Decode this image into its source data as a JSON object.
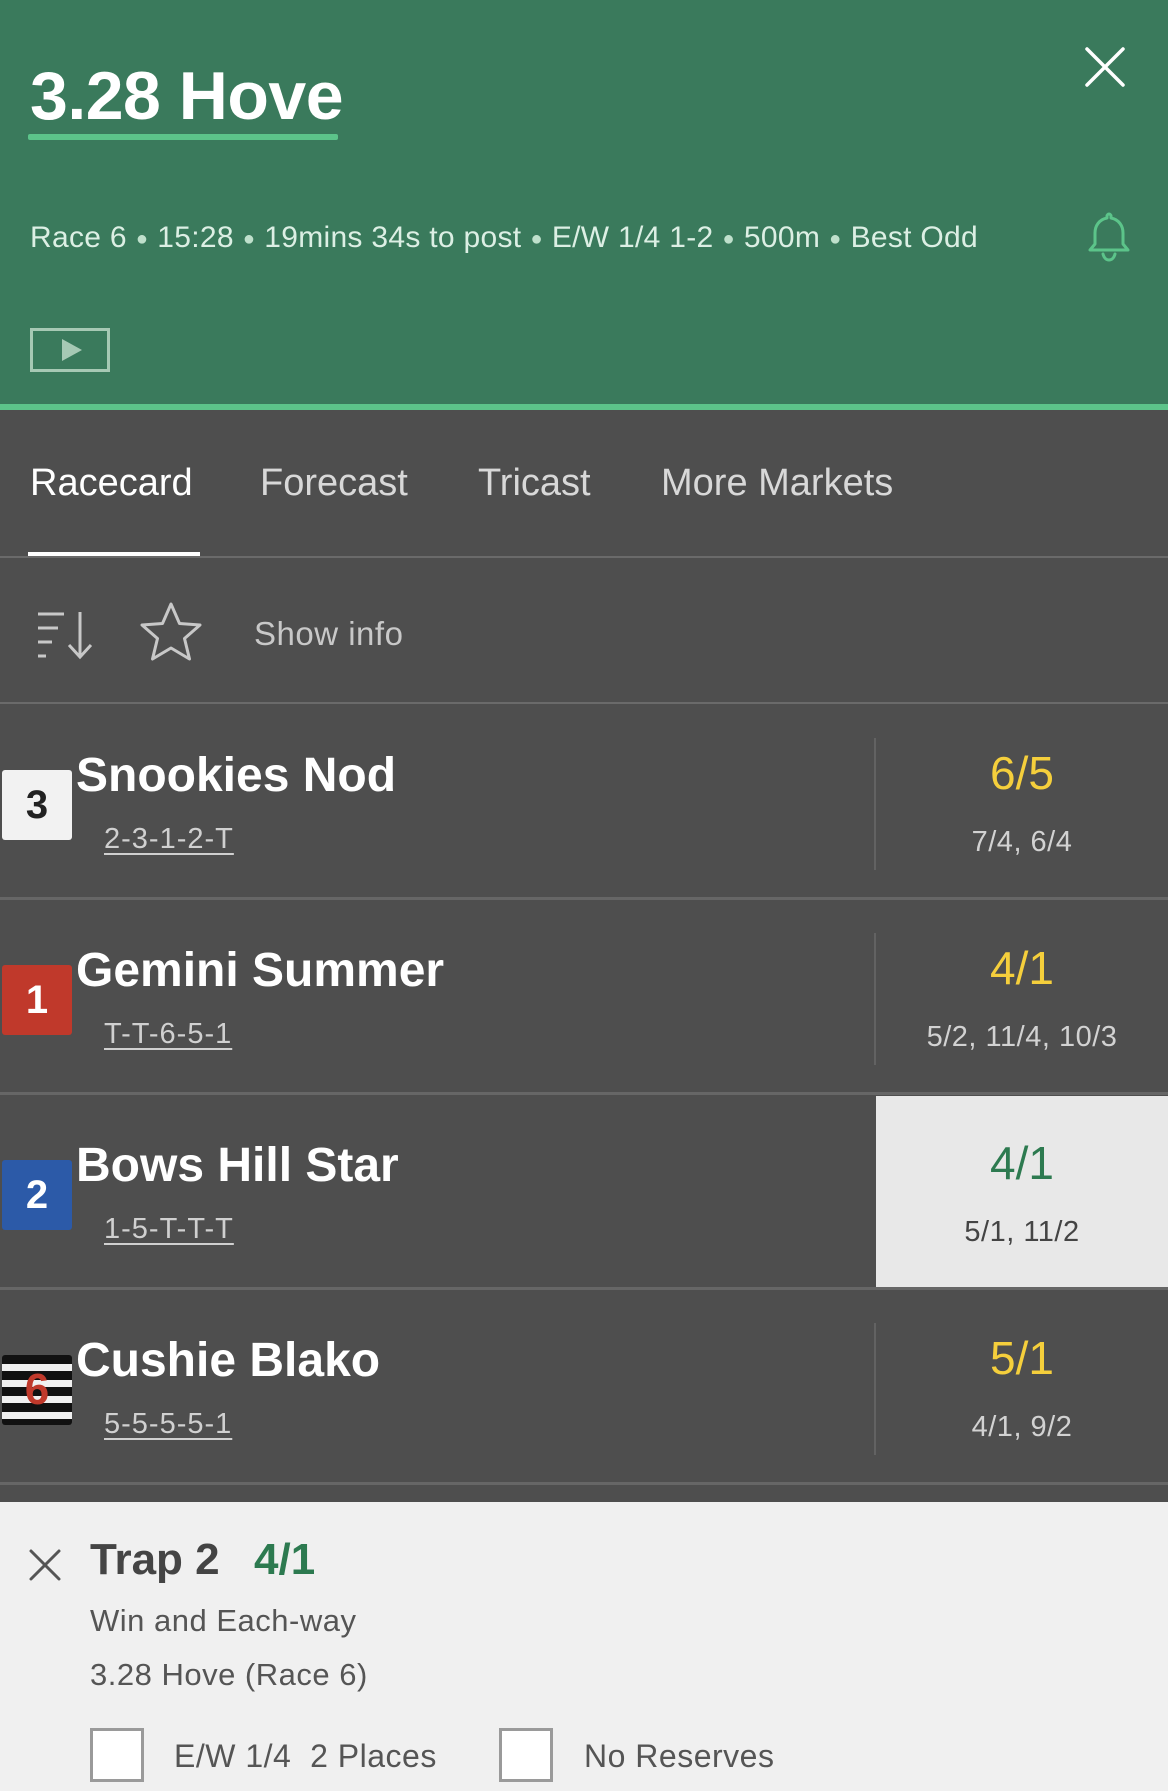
{
  "header": {
    "title": "3.28 Hove",
    "race": "Race 6",
    "time": "15:28",
    "countdown": "19mins 34s to post",
    "each_way": "E/W 1/4 1-2",
    "distance": "500m",
    "odds_type": "Best Odd",
    "icons": {
      "close": "close-icon",
      "bell": "bell-icon",
      "video": "play-video-icon"
    }
  },
  "tabs": [
    {
      "label": "Racecard",
      "active": true
    },
    {
      "label": "Forecast",
      "active": false
    },
    {
      "label": "Tricast",
      "active": false
    },
    {
      "label": "More Markets",
      "active": false
    }
  ],
  "toolbar": {
    "show_info_label": "Show info",
    "icons": {
      "sort": "sort-icon",
      "favourite": "star-icon"
    }
  },
  "runners": [
    {
      "trap": "3",
      "name": "Snookies Nod",
      "form": "2-3-1-2-T",
      "odds": "6/5",
      "previous_odds": "7/4, 6/4",
      "selected": false
    },
    {
      "trap": "1",
      "name": "Gemini Summer",
      "form": "T-T-6-5-1",
      "odds": "4/1",
      "previous_odds": "5/2, 11/4, 10/3",
      "selected": false
    },
    {
      "trap": "2",
      "name": "Bows Hill Star",
      "form": "1-5-T-T-T",
      "odds": "4/1",
      "previous_odds": "5/1, 11/2",
      "selected": true
    },
    {
      "trap": "6",
      "name": "Cushie Blako",
      "form": "5-5-5-5-1",
      "odds": "5/1",
      "previous_odds": "4/1, 9/2",
      "selected": false
    }
  ],
  "betslip": {
    "selection": "Trap 2",
    "odds": "4/1",
    "bet_type": "Win and Each-way",
    "event": "3.28 Hove (Race 6)",
    "each_way_option": "E/W 1/4  2 Places",
    "reserves_option": "No Reserves",
    "each_way_checked": false,
    "reserves_checked": false
  },
  "colors": {
    "header_bg": "#3a7a5c",
    "accent_green": "#5cc48a",
    "odds_yellow": "#f5cf3c",
    "selected_odds_green": "#2d7a50",
    "panel_bg": "#4e4e4e"
  }
}
